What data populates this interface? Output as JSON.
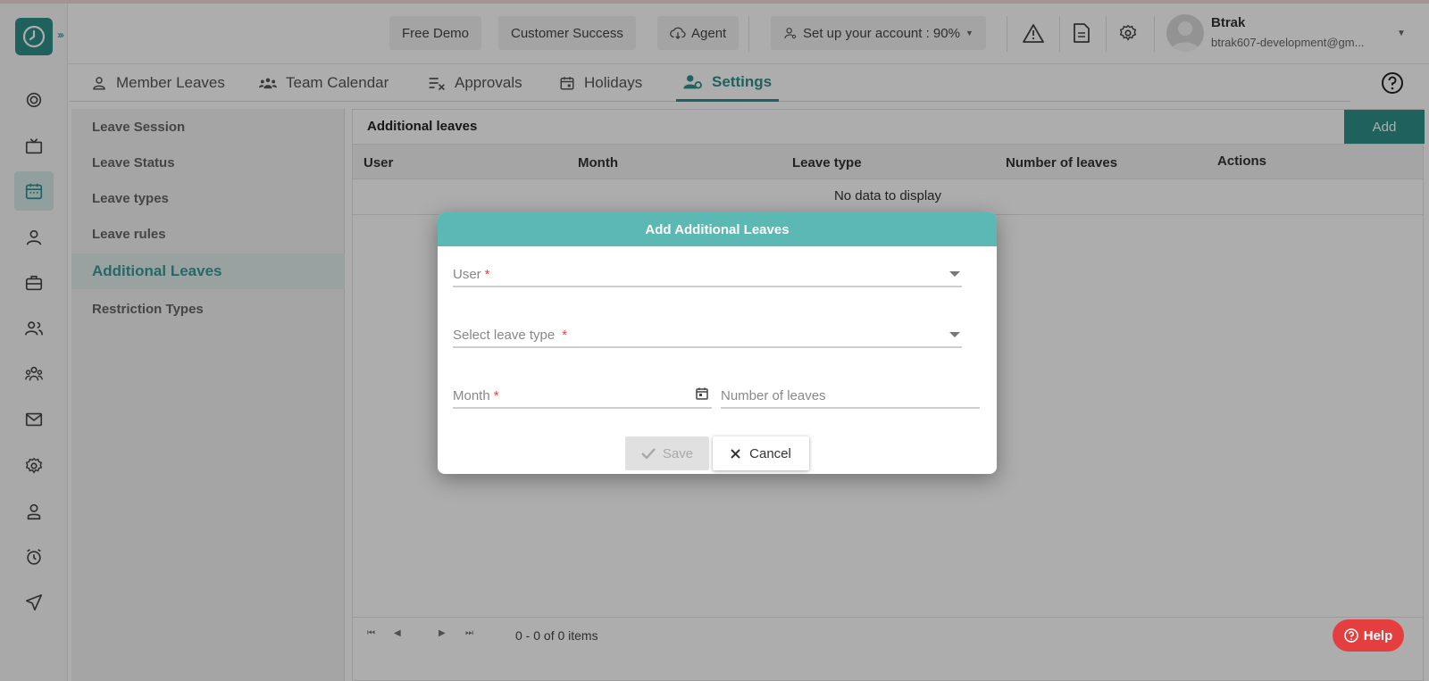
{
  "header": {
    "free_demo": "Free Demo",
    "customer_success": "Customer Success",
    "agent": "Agent",
    "setup_account": "Set up your account : 90%",
    "user_name": "Btrak",
    "user_email": "btrak607-development@gm..."
  },
  "tabs": [
    "Member Leaves",
    "Team Calendar",
    "Approvals",
    "Holidays",
    "Settings"
  ],
  "active_tab": "Settings",
  "left_menu": [
    "Leave Session",
    "Leave Status",
    "Leave types",
    "Leave rules",
    "Additional Leaves",
    "Restriction Types"
  ],
  "active_left_menu": "Additional Leaves",
  "content": {
    "title": "Additional leaves",
    "add_label": "Add",
    "columns": [
      "User",
      "Month",
      "Leave type",
      "Number of leaves",
      "Actions"
    ],
    "empty_text": "No data to display",
    "pager_info": "0 - 0 of 0 items"
  },
  "modal": {
    "title": "Add Additional Leaves",
    "user_label": "User",
    "leave_type_label": "Select leave type",
    "month_label": "Month",
    "num_leaves_label": "Number of leaves",
    "required_mark": "*",
    "save_label": "Save",
    "cancel_label": "Cancel"
  },
  "help_label": "Help",
  "colors": {
    "brand": "#2f8f8a",
    "modal_header": "#5bb8b3",
    "help": "#e53e3e"
  }
}
